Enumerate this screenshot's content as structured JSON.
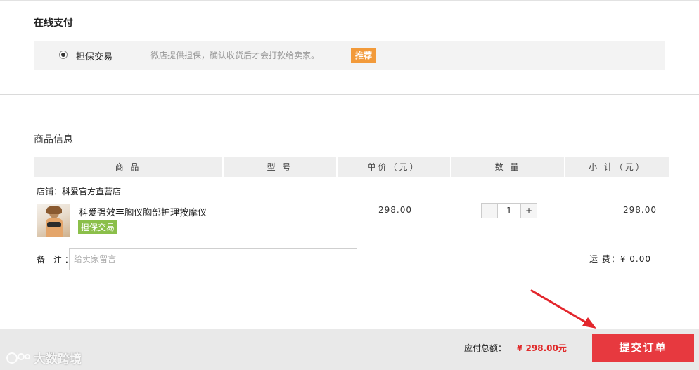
{
  "payment": {
    "section_title": "在线支付",
    "option_label": "担保交易",
    "option_desc": "微店提供担保，确认收货后才会打款给卖家。",
    "recommend_badge": "推荐"
  },
  "goods": {
    "section_title": "商品信息",
    "columns": [
      "商 品",
      "型 号",
      "单价（元）",
      "数 量",
      "小 计（元）"
    ],
    "shop_label": "店铺：科爱官方直营店",
    "item": {
      "name": "科爱强效丰胸仪胸部护理按摩仪",
      "tag": "担保交易",
      "unit_price": "298.00",
      "quantity": "1",
      "qty_minus": "-",
      "qty_plus": "+",
      "subtotal": "298.00"
    },
    "remark": {
      "label": "备 注：",
      "placeholder": "给卖家留言",
      "value": ""
    },
    "shipping": "运 费：¥ 0.00"
  },
  "footer": {
    "total_label": "应付总额：",
    "total_value": "¥ 298.00元",
    "submit_label": "提交订单"
  },
  "watermark": {
    "text": "大数跨境"
  },
  "colors": {
    "accent_red": "#e7393f",
    "price_red": "#e02b2b",
    "badge_orange": "#f29a3a",
    "tag_green": "#8bbf4a"
  },
  "icons": {
    "radio": "radio-selected-icon",
    "arrow": "red-arrow-icon",
    "watermark": "watermark-logo-icon"
  }
}
